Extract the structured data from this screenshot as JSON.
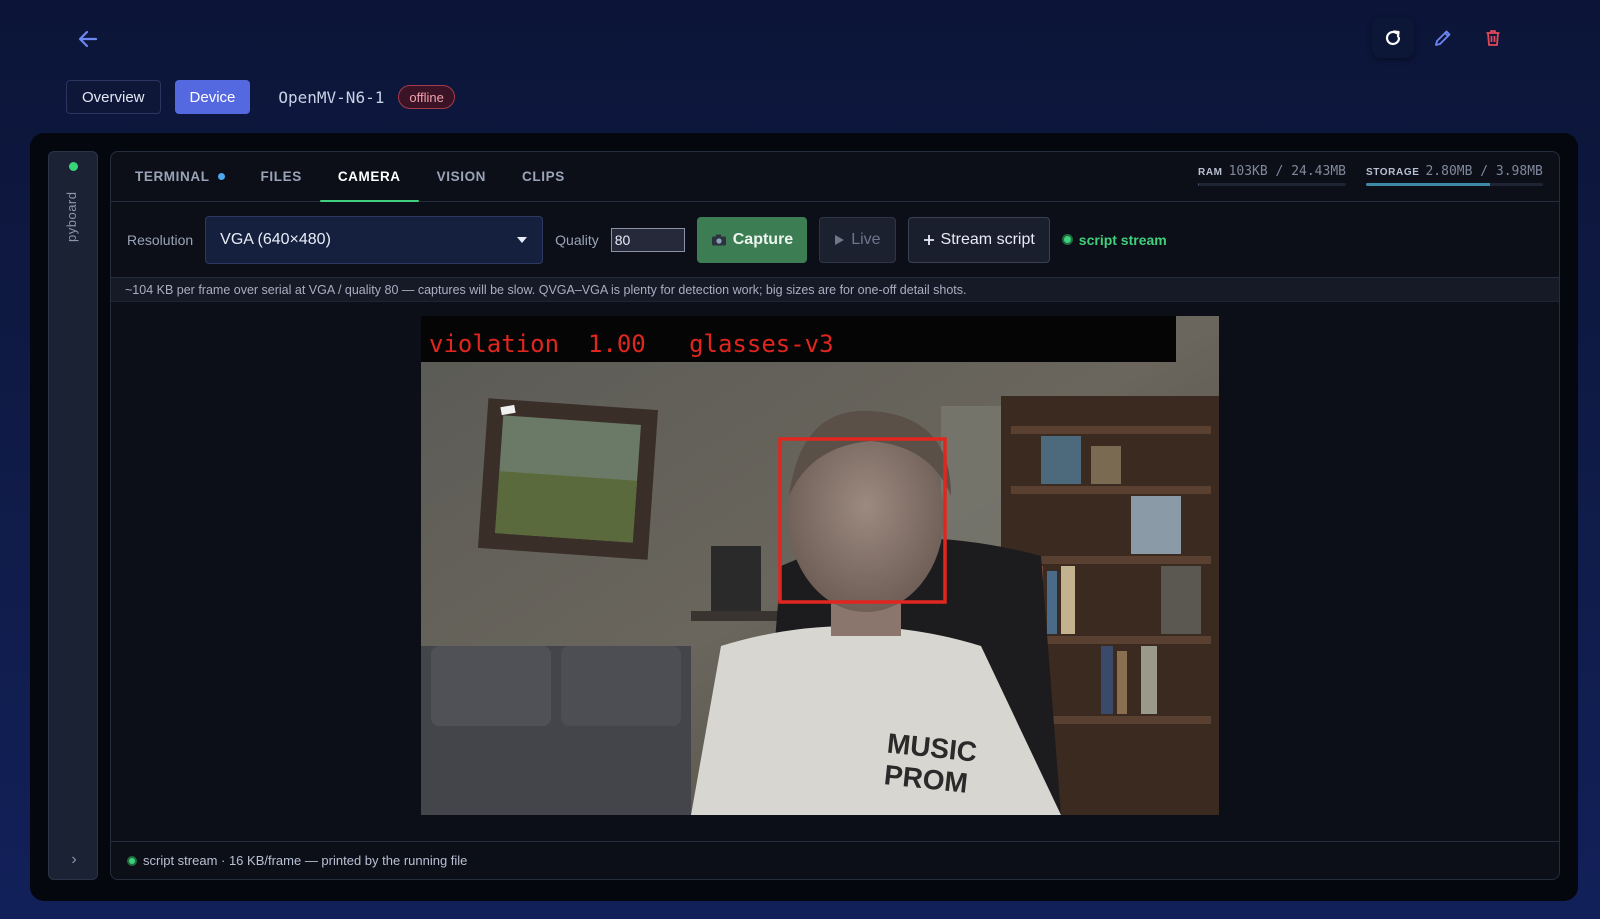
{
  "header": {
    "back_icon": "arrow-left-icon",
    "actions": [
      {
        "name": "refresh",
        "icon": "refresh-icon"
      },
      {
        "name": "edit",
        "icon": "pencil-icon"
      },
      {
        "name": "delete",
        "icon": "trash-icon"
      }
    ],
    "view_tabs": {
      "overview": "Overview",
      "device": "Device"
    },
    "device_name": "OpenMV-N6-1",
    "status_badge": "offline"
  },
  "sidebar": {
    "label": "pyboard",
    "connected": true,
    "expand_glyph": "›"
  },
  "tabs": [
    {
      "label": "TERMINAL",
      "has_dot": true,
      "active": false
    },
    {
      "label": "FILES",
      "has_dot": false,
      "active": false
    },
    {
      "label": "CAMERA",
      "has_dot": false,
      "active": true
    },
    {
      "label": "VISION",
      "has_dot": false,
      "active": false
    },
    {
      "label": "CLIPS",
      "has_dot": false,
      "active": false
    }
  ],
  "metrics": {
    "ram": {
      "key": "RAM",
      "value": "103KB / 24.43MB",
      "used_fraction": 0.004
    },
    "storage": {
      "key": "STORAGE",
      "value": "2.80MB / 3.98MB",
      "used_fraction": 0.7
    }
  },
  "toolbar": {
    "resolution_label": "Resolution",
    "resolution_value": "VGA (640×480)",
    "quality_label": "Quality",
    "quality_value": "80",
    "capture_label": "Capture",
    "capture_icon": "camera-icon",
    "live_label": "Live",
    "live_icon": "play-icon",
    "stream_script_label": "Stream script",
    "stream_script_icon": "plus-icon",
    "stream_status": "script stream"
  },
  "hint": "~104 KB per frame over serial at VGA / quality 80 — captures will be slow. QVGA–VGA is plenty for detection work; big sizes are for one-off detail shots.",
  "frame": {
    "overlay_text": "violation  1.00   glasses-v3",
    "detection_label": "violation",
    "detection_score": "1.00",
    "model": "glasses-v3",
    "shirt_text": "MUSIC PROM"
  },
  "footer": {
    "status": "script stream · 16 KB/frame — printed by the running file"
  },
  "colors": {
    "accent": "#5468e0",
    "success": "#3fd07e",
    "danger": "#e04a5a",
    "detection_box": "#e0261e"
  }
}
